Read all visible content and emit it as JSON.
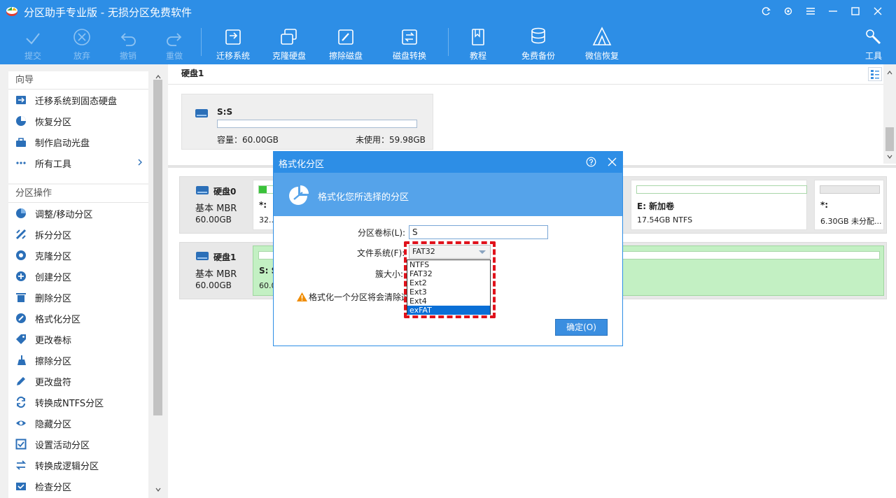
{
  "window": {
    "title": "分区助手专业版 - 无损分区免费软件"
  },
  "toolbar": {
    "items": [
      {
        "label": "提交",
        "icon": "check-icon",
        "enabled": false
      },
      {
        "label": "放弃",
        "icon": "cancel-icon",
        "enabled": false
      },
      {
        "label": "撤销",
        "icon": "undo-icon",
        "enabled": false
      },
      {
        "label": "重做",
        "icon": "redo-icon",
        "enabled": false
      },
      {
        "label": "迁移系统",
        "icon": "migrate-os-icon",
        "enabled": true
      },
      {
        "label": "克隆硬盘",
        "icon": "clone-disk-icon",
        "enabled": true
      },
      {
        "label": "擦除磁盘",
        "icon": "wipe-disk-icon",
        "enabled": true
      },
      {
        "label": "磁盘转换",
        "icon": "disk-convert-icon",
        "enabled": true
      },
      {
        "label": "教程",
        "icon": "tutorial-book-icon",
        "enabled": true
      },
      {
        "label": "免费备份",
        "icon": "backup-icon",
        "enabled": true
      },
      {
        "label": "微信恢复",
        "icon": "wechat-recovery-icon",
        "enabled": true
      },
      {
        "label": "工具",
        "icon": "tools-wrench-icon",
        "enabled": true
      }
    ]
  },
  "sidebar": {
    "wizard": {
      "heading": "向导",
      "items": [
        "迁移系统到固态硬盘",
        "恢复分区",
        "制作启动光盘",
        "所有工具"
      ]
    },
    "operations": {
      "heading": "分区操作",
      "items": [
        "调整/移动分区",
        "拆分分区",
        "克隆分区",
        "创建分区",
        "删除分区",
        "格式化分区",
        "更改卷标",
        "擦除分区",
        "更改盘符",
        "转换成NTFS分区",
        "隐藏分区",
        "设置活动分区",
        "转换成逻辑分区",
        "检查分区"
      ]
    }
  },
  "upper": {
    "disk_title": "硬盘1",
    "partition": {
      "name": "S:S",
      "capacity": "容量：60.00GB",
      "unused": "未使用：59.98GB"
    }
  },
  "disks": [
    {
      "name": "硬盘0",
      "type": "基本 MBR",
      "size": "60.00GB",
      "partitions": [
        {
          "name": "*:",
          "detail": "32...",
          "fill": 0.05
        },
        {
          "name": "E: 新加卷",
          "detail": "17.54GB NTFS",
          "fill": 0.0
        },
        {
          "name": "*:",
          "detail": "6.30GB 未分配...",
          "fill": 0.0
        }
      ]
    },
    {
      "name": "硬盘1",
      "type": "基本 MBR",
      "size": "60.00GB",
      "partitions": [
        {
          "name": "S: S",
          "detail": "60.0",
          "fill": 0.0
        }
      ]
    }
  ],
  "dialog": {
    "title": "格式化分区",
    "header": "格式化您所选择的分区",
    "label_volume": "分区卷标(L):",
    "volume_value": "S",
    "label_fs": "文件系统(F):",
    "fs_value": "FAT32",
    "label_cluster": "簇大小:",
    "warning": "格式化一个分区将会清除这",
    "ok_button": "确定(O)",
    "fs_options": [
      "NTFS",
      "FAT32",
      "Ext2",
      "Ext3",
      "Ext4",
      "exFAT"
    ],
    "fs_highlighted": "exFAT"
  },
  "colors": {
    "accent": "#2d8ee6",
    "highlight_box": "#e0121b",
    "partition_green": "#3ac23a"
  }
}
